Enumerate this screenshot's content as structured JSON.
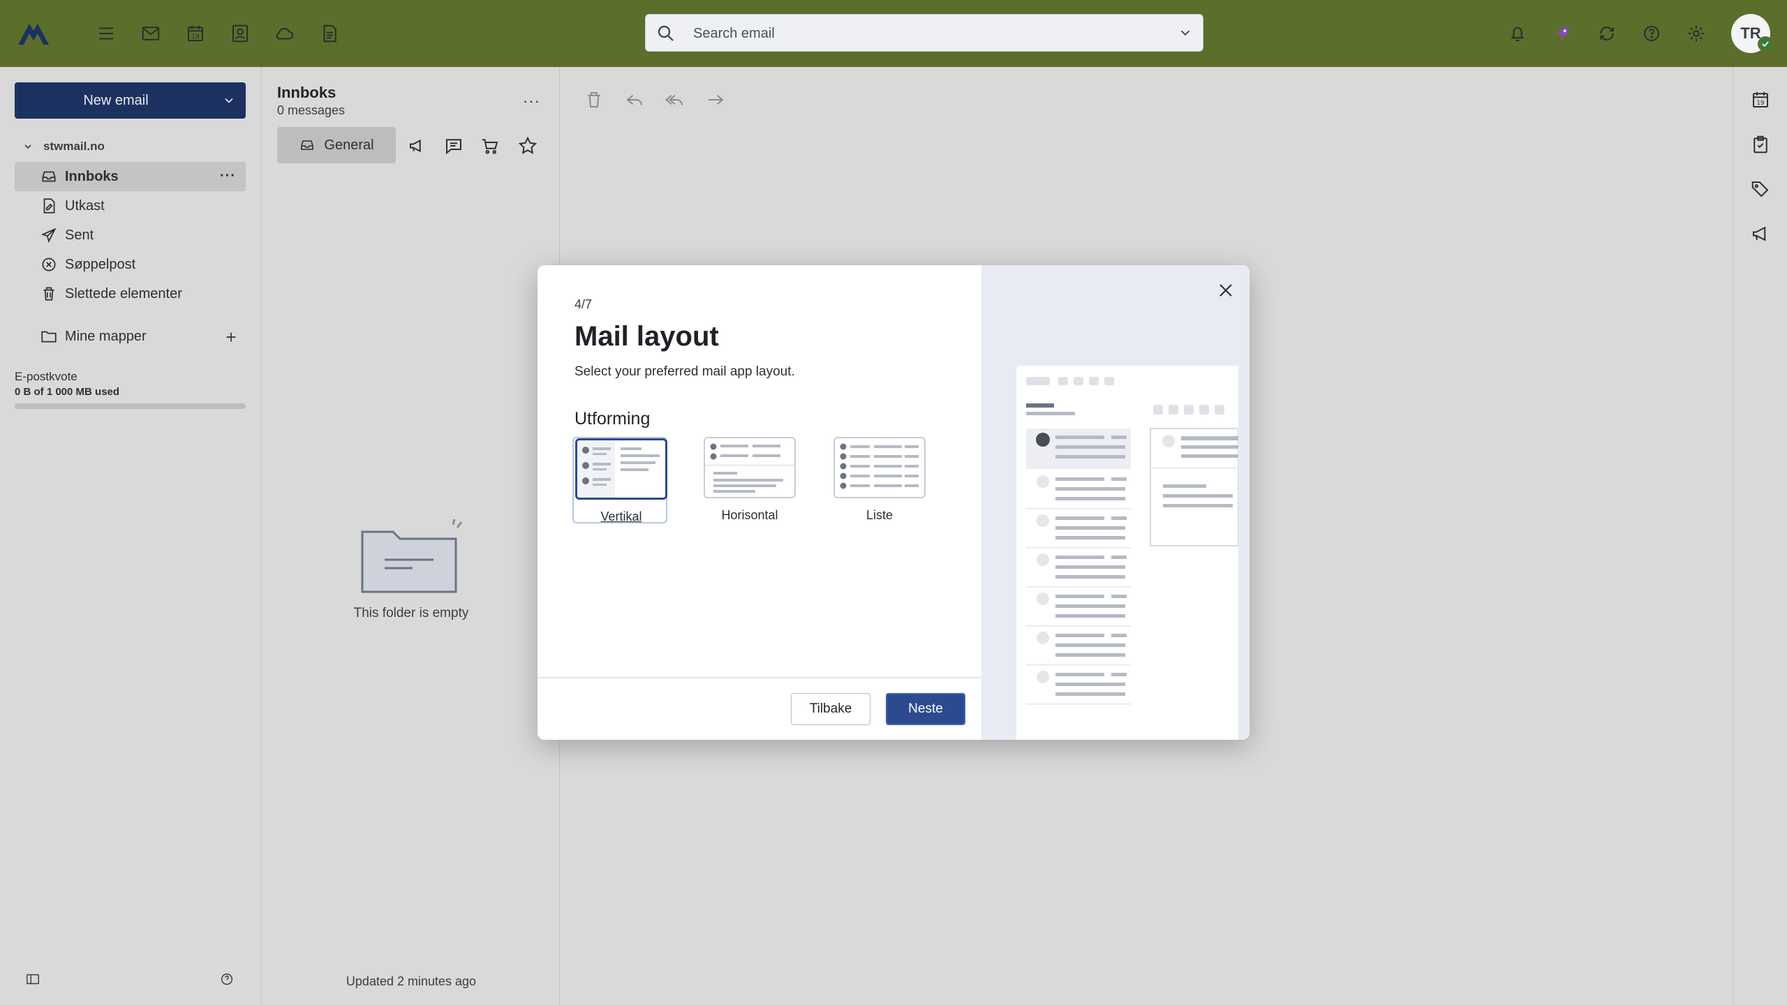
{
  "topbar": {
    "search_placeholder": "Search email",
    "avatar_initials": "TR",
    "nav_icons": [
      "menu-icon",
      "mail-icon",
      "calendar-icon",
      "contacts-icon",
      "cloud-icon",
      "document-icon"
    ],
    "right_icons": [
      "bell-icon",
      "rocket-icon",
      "sync-icon",
      "help-icon",
      "gear-icon"
    ],
    "bar_color": "#5b6e2c"
  },
  "sidebar": {
    "new_email_label": "New email",
    "account": "stwmail.no",
    "folders": [
      {
        "label": "Innboks",
        "icon": "inbox-icon",
        "active": true
      },
      {
        "label": "Utkast",
        "icon": "draft-icon"
      },
      {
        "label": "Sent",
        "icon": "send-icon"
      },
      {
        "label": "Søppelpost",
        "icon": "spam-icon"
      },
      {
        "label": "Slettede elementer",
        "icon": "trash-icon"
      }
    ],
    "more_label": "···",
    "my_folders_label": "Mine mapper",
    "quota_label": "E-postkvote",
    "quota_used": "0 B of 1 000 MB used",
    "quota_fraction": 0
  },
  "list": {
    "title": "Innboks",
    "count": "0 messages",
    "more_label": "···",
    "tab_general": "General",
    "empty_text": "This folder is empty",
    "updated": "Updated 2 minutes ago"
  },
  "modal": {
    "step": "4/7",
    "title": "Mail layout",
    "subtitle": "Select your preferred mail app layout.",
    "section": "Utforming",
    "options": [
      {
        "label": "Vertikal",
        "selected": true
      },
      {
        "label": "Horisontal"
      },
      {
        "label": "Liste"
      }
    ],
    "back_label": "Tilbake",
    "next_label": "Neste",
    "accent": "#2b4a8f"
  }
}
